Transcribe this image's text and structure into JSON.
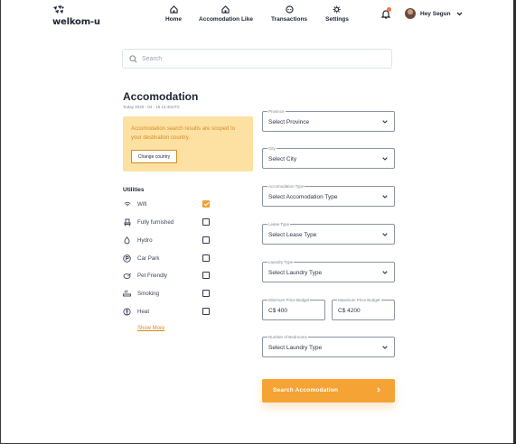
{
  "brand": {
    "name": "welkom-u"
  },
  "nav": [
    {
      "label": "Home",
      "icon": "home-icon"
    },
    {
      "label": "Accomodation Like",
      "icon": "home-icon"
    },
    {
      "label": "Transactions",
      "icon": "chat-icon"
    },
    {
      "label": "Settings",
      "icon": "gear-icon"
    }
  ],
  "user": {
    "greeting": "Hey Segun",
    "notifications_dot_color": "#f4753c"
  },
  "search": {
    "placeholder": "Search"
  },
  "page": {
    "title": "Accomodation",
    "date": "Today 2020 - 04 - 15   14:40UTC"
  },
  "notice": {
    "text": "Accomodation search results are scoped to your destination country.",
    "button": "Change country"
  },
  "utilities": {
    "title": "Utilities",
    "items": [
      {
        "label": "Wifi",
        "checked": true,
        "icon": "wifi-icon"
      },
      {
        "label": "Fully furnished",
        "checked": false,
        "icon": "chair-icon"
      },
      {
        "label": "Hydro",
        "checked": false,
        "icon": "water-drop-icon"
      },
      {
        "label": "Car Park",
        "checked": false,
        "icon": "parking-icon"
      },
      {
        "label": "Pet Friendly",
        "checked": false,
        "icon": "pet-icon"
      },
      {
        "label": "Smoking",
        "checked": false,
        "icon": "smoking-icon"
      },
      {
        "label": "Heat",
        "checked": false,
        "icon": "heat-icon"
      }
    ],
    "show_more": "Show More"
  },
  "form": {
    "province": {
      "label": "Province",
      "value": "Select Province"
    },
    "city": {
      "label": "City",
      "value": "Select City"
    },
    "accom_type": {
      "label": "Accomodation Type",
      "value": "Select Accomodation Type"
    },
    "lease_type": {
      "label": "Lease Type",
      "value": "Select Lease Type"
    },
    "laundry_type": {
      "label": "Laundry Type",
      "value": "Select Laundry Type"
    },
    "min_budget": {
      "label": "Minimum Price Budget",
      "value": "C$ 400"
    },
    "max_budget": {
      "label": "Maximum Price Budget",
      "value": "C$ 4200"
    },
    "bedrooms": {
      "label": "Number of Bedrooms",
      "value": "Select Laundry Type"
    },
    "submit": "Search Accomodation"
  },
  "colors": {
    "accent": "#f5a334",
    "notice_bg": "#fde1a3",
    "text": "#1b2433"
  }
}
